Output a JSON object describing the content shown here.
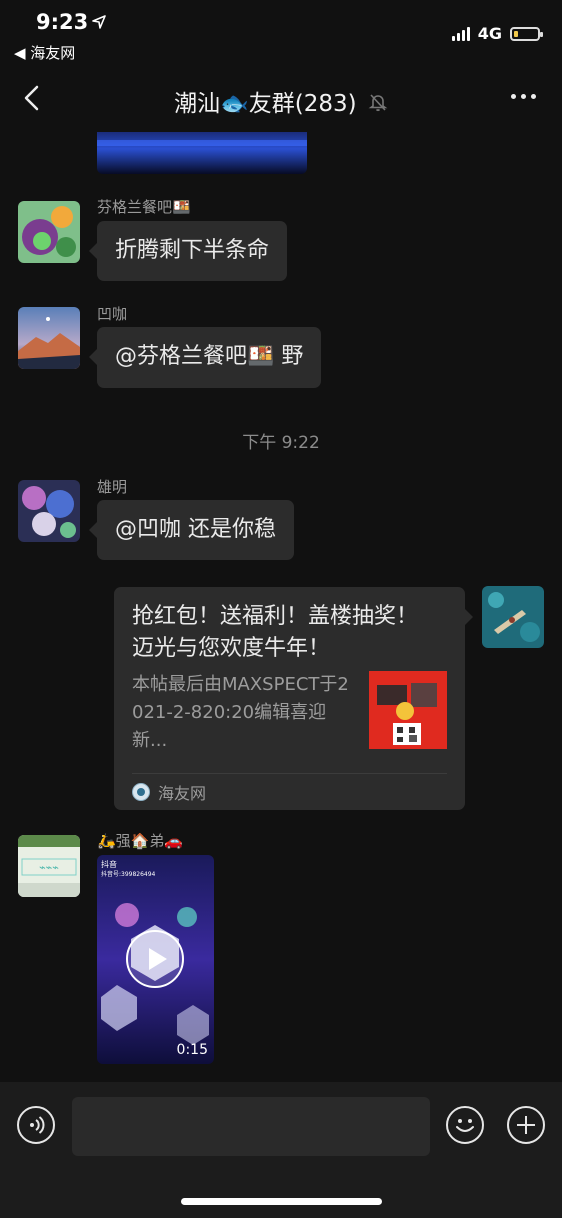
{
  "status_bar": {
    "time": "9:23",
    "back_app": "◀ 海友网",
    "network": "4G",
    "battery_level": 0.2,
    "battery_color": "#f2c94c"
  },
  "nav": {
    "title": "潮汕🐟友群(283)",
    "muted_icon": "bell-off-icon"
  },
  "messages": [
    {
      "sender": "芬格兰餐吧🍱",
      "text": "折腾剩下半条命"
    },
    {
      "sender": "凹咖",
      "text": "@芬格兰餐吧🍱 野"
    },
    {
      "sender": "雄明",
      "text": "@凹咖 还是你稳"
    }
  ],
  "timestamp": "下午 9:22",
  "link_card": {
    "title": "抢红包！送福利！盖楼抽奖！迈光与您欢度牛年！",
    "description": "本帖最后由MAXSPECT于2021-2-820:20编辑喜迎新...",
    "source": "海友网"
  },
  "video_message": {
    "sender": "🛵强🏠弟🚗",
    "duration": "0:15",
    "app_label": "抖音",
    "account_text": "抖音号:399826494"
  },
  "colors": {
    "background": "#111111",
    "bubble": "#2c2c2c",
    "bottom_bar": "#1c1c1c"
  }
}
